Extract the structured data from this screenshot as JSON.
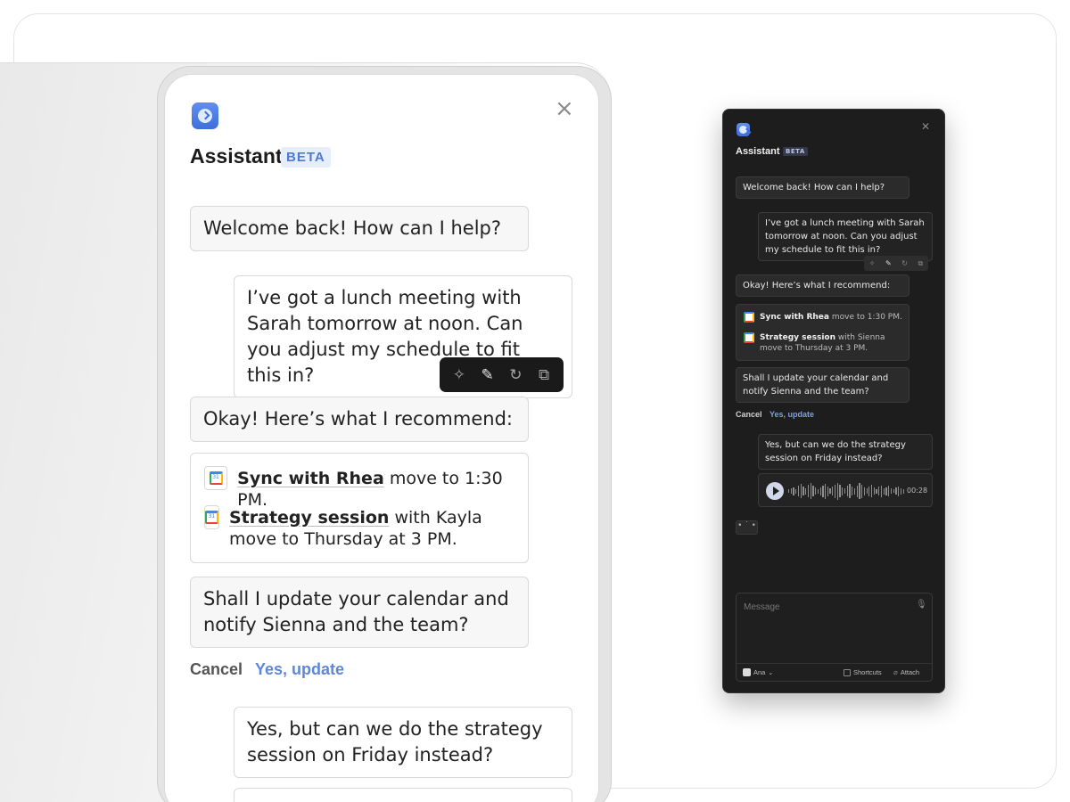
{
  "light_panel": {
    "title": "Assistant",
    "badge": "BETA",
    "close_glyph": "×",
    "messages": {
      "welcome": "Welcome back! How can I help?",
      "user_request": "I’ve got a lunch meeting with Sarah tomorrow at noon. Can you adjust my schedule to fit this in?",
      "recommend": "Okay! Here’s what I recommend:",
      "rec1_bold": "Sync with Rhea",
      "rec1_rest": " move to 1:30 PM.",
      "rec2_bold": "Strategy session",
      "rec2_rest": " with Kayla move to Thursday at 3 PM.",
      "confirm": "Shall I update your calendar and notify Sienna and the team?",
      "user_followup": "Yes, but can we do the strategy session on Friday instead?"
    },
    "cancel_label": "Cancel",
    "yes_label": "Yes, update",
    "toolbar_icons": [
      "sparkle-icon",
      "pencil-icon",
      "refresh-icon",
      "copy-icon"
    ],
    "calendar_day": "31"
  },
  "dark_panel": {
    "title": "Assistant",
    "badge": "BETA",
    "close_glyph": "✕",
    "messages": {
      "welcome": "Welcome back! How can I help?",
      "user_request": "I’ve got a lunch meeting with Sarah tomorrow at noon. Can you adjust my schedule to fit this in?",
      "recommend": "Okay! Here’s what I recommend:",
      "rec1_bold": "Sync with Rhea",
      "rec1_rest": " move to 1:30 PM.",
      "rec2_bold": "Strategy session",
      "rec2_rest": " with Sienna move to Thursday at 3 PM.",
      "confirm": "Shall I update your calendar and notify Sienna and the team?",
      "user_followup": "Yes, but can we do the strategy session on Friday instead?"
    },
    "cancel_label": "Cancel",
    "yes_label": "Yes, update",
    "audio_duration": "00:28",
    "typing_indicator": "• ˙ •",
    "composer": {
      "placeholder": "Message",
      "user_label": "Ana",
      "user_caret": "⌄",
      "shortcuts_label": "Shortcuts",
      "attach_label": "Attach"
    }
  },
  "colors": {
    "accent_blue": "#5e87d8",
    "dark_bg": "#1d1d1d",
    "light_bubble": "#f7f7f7"
  }
}
